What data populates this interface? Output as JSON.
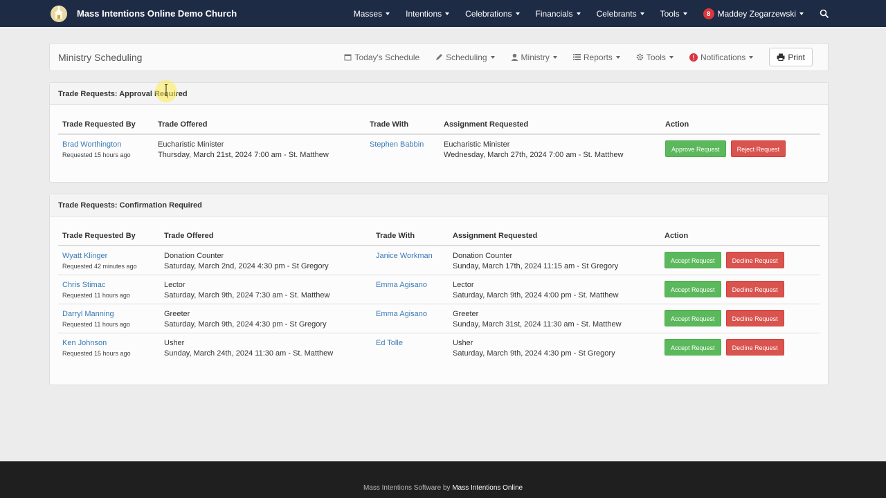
{
  "topnav": {
    "brand": "Mass Intentions Online Demo Church",
    "menus": [
      "Masses",
      "Intentions",
      "Celebrations",
      "Financials",
      "Celebrants",
      "Tools"
    ],
    "notification_count": "8",
    "user": "Maddey Zegarzewski"
  },
  "subheader": {
    "title": "Ministry Scheduling",
    "nav": {
      "today": "Today's Schedule",
      "scheduling": "Scheduling",
      "ministry": "Ministry",
      "reports": "Reports",
      "tools": "Tools",
      "notifications": "Notifications",
      "notifications_alert": "!",
      "print": "Print"
    }
  },
  "approval_panel": {
    "title": "Trade Requests: Approval Required",
    "columns": [
      "Trade Requested By",
      "Trade Offered",
      "Trade With",
      "Assignment Requested",
      "Action"
    ],
    "rows": [
      {
        "requester": "Brad Worthington",
        "requested": "Requested 15 hours ago",
        "offered_role": "Eucharistic Minister",
        "offered_time": "Thursday, March 21st, 2024 7:00 am - St. Matthew",
        "trade_with": "Stephen Babbin",
        "assign_role": "Eucharistic Minister",
        "assign_time": "Wednesday, March 27th, 2024 7:00 am - St. Matthew",
        "approve": "Approve Request",
        "reject": "Reject Request"
      }
    ]
  },
  "confirmation_panel": {
    "title": "Trade Requests: Confirmation Required",
    "columns": [
      "Trade Requested By",
      "Trade Offered",
      "Trade With",
      "Assignment Requested",
      "Action"
    ],
    "rows": [
      {
        "requester": "Wyatt Klinger",
        "requested": "Requested 42 minutes ago",
        "offered_role": "Donation Counter",
        "offered_time": "Saturday, March 2nd, 2024 4:30 pm - St Gregory",
        "trade_with": "Janice Workman",
        "assign_role": "Donation Counter",
        "assign_time": "Sunday, March 17th, 2024 11:15 am - St Gregory",
        "accept": "Accept Request",
        "decline": "Decline Request"
      },
      {
        "requester": "Chris Stimac",
        "requested": "Requested 11 hours ago",
        "offered_role": "Lector",
        "offered_time": "Saturday, March 9th, 2024 7:30 am - St. Matthew",
        "trade_with": "Emma Agisano",
        "assign_role": "Lector",
        "assign_time": "Saturday, March 9th, 2024 4:00 pm - St. Matthew",
        "accept": "Accept Request",
        "decline": "Decline Request"
      },
      {
        "requester": "Darryl Manning",
        "requested": "Requested 11 hours ago",
        "offered_role": "Greeter",
        "offered_time": "Saturday, March 9th, 2024 4:30 pm - St Gregory",
        "trade_with": "Emma Agisano",
        "assign_role": "Greeter",
        "assign_time": "Sunday, March 31st, 2024 11:30 am - St. Matthew",
        "accept": "Accept Request",
        "decline": "Decline Request"
      },
      {
        "requester": "Ken Johnson",
        "requested": "Requested 15 hours ago",
        "offered_role": "Usher",
        "offered_time": "Sunday, March 24th, 2024 11:30 am - St. Matthew",
        "trade_with": "Ed Tolle",
        "assign_role": "Usher",
        "assign_time": "Saturday, March 9th, 2024 4:30 pm - St Gregory",
        "accept": "Accept Request",
        "decline": "Decline Request"
      }
    ]
  },
  "footer": {
    "prefix": "Mass Intentions Software by",
    "brand": "Mass Intentions Online"
  },
  "colors": {
    "navbar": "#1d2b45",
    "link": "#3a79b8",
    "success": "#5cb85c",
    "danger": "#d9534f",
    "footer": "#1f1f1f"
  },
  "icons": [
    "church-logo-icon",
    "search-icon",
    "calendar-icon",
    "pencil-icon",
    "user-icon",
    "list-icon",
    "gear-icon",
    "alert-icon",
    "printer-icon",
    "ibeam-cursor-icon"
  ]
}
